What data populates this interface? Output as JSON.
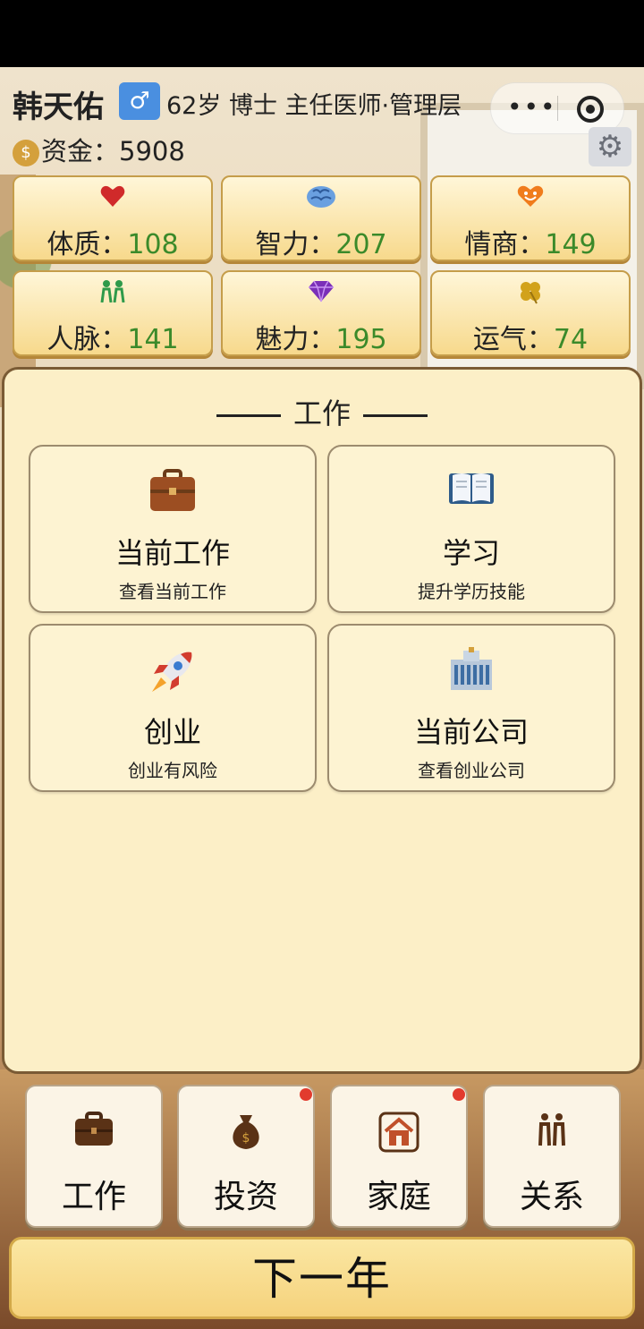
{
  "header": {
    "name": "韩天佑",
    "gender_symbol": "♂",
    "info": "62岁 博士 主任医师·管理层",
    "money_label": "资金：",
    "money_value": "5908",
    "menu_dots": "•••",
    "gear_glyph": "⚙"
  },
  "stats": [
    {
      "icon": "heart-icon",
      "label": "体质：",
      "value": "108",
      "color": "#d02a2a"
    },
    {
      "icon": "brain-icon",
      "label": "智力：",
      "value": "207",
      "color": "#3b6fb5"
    },
    {
      "icon": "smile-icon",
      "label": "情商：",
      "value": "149",
      "color": "#f07c1c"
    },
    {
      "icon": "people-icon",
      "label": "人脉：",
      "value": "141",
      "color": "#2f9a4a"
    },
    {
      "icon": "diamond-icon",
      "label": "魅力：",
      "value": "195",
      "color": "#7b2fb8"
    },
    {
      "icon": "clover-icon",
      "label": "运气：",
      "value": "74",
      "color": "#d2a21b"
    }
  ],
  "panel": {
    "title": "工作",
    "cards": [
      {
        "title": "当前工作",
        "subtitle": "查看当前工作",
        "icon": "briefcase-icon"
      },
      {
        "title": "学习",
        "subtitle": "提升学历技能",
        "icon": "book-icon"
      },
      {
        "title": "创业",
        "subtitle": "创业有风险",
        "icon": "rocket-icon"
      },
      {
        "title": "当前公司",
        "subtitle": "查看创业公司",
        "icon": "office-building-icon"
      }
    ]
  },
  "nav": [
    {
      "label": "工作",
      "icon": "briefcase-icon",
      "badge": false
    },
    {
      "label": "投资",
      "icon": "money-bag-icon",
      "badge": true
    },
    {
      "label": "家庭",
      "icon": "house-icon",
      "badge": true
    },
    {
      "label": "关系",
      "icon": "couple-icon",
      "badge": false
    }
  ],
  "next_year": "下一年"
}
